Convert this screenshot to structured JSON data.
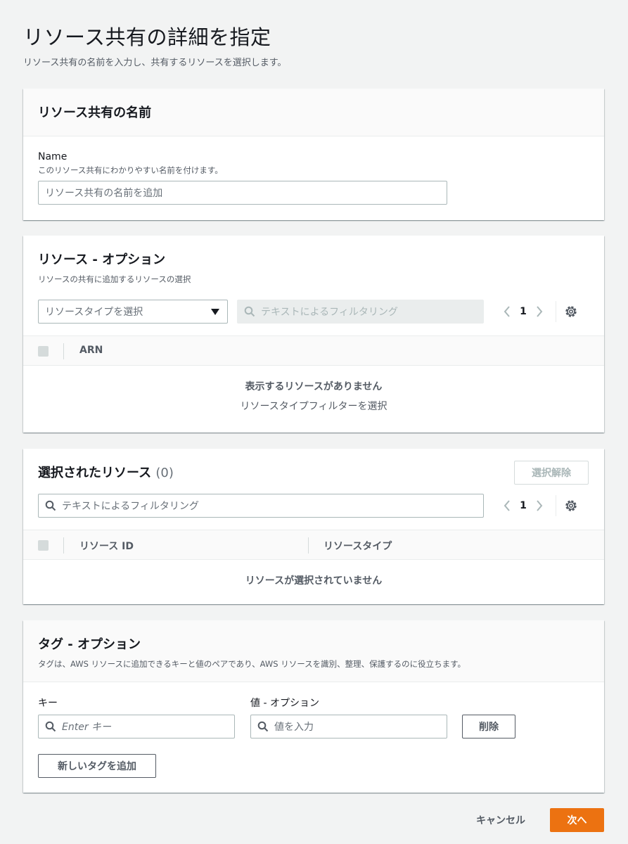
{
  "page": {
    "title": "リソース共有の詳細を指定",
    "description": "リソース共有の名前を入力し、共有するリソースを選択します。"
  },
  "name_panel": {
    "title": "リソース共有の名前",
    "field_label": "Name",
    "field_hint": "このリソース共有にわかりやすい名前を付けます。",
    "input_placeholder": "リソース共有の名前を追加"
  },
  "resources_panel": {
    "title": "リソース - オプション",
    "description": "リソースの共有に追加するリソースの選択",
    "type_select_placeholder": "リソースタイプを選択",
    "filter_placeholder": "テキストによるフィルタリング",
    "page_number": "1",
    "column_arn": "ARN",
    "empty_title": "表示するリソースがありません",
    "empty_subtitle": "リソースタイプフィルターを選択"
  },
  "selected_panel": {
    "title": "選択されたリソース",
    "count": "(0)",
    "deselect_button": "選択解除",
    "filter_placeholder": "テキストによるフィルタリング",
    "page_number": "1",
    "column_resource_id": "リソース ID",
    "column_resource_type": "リソースタイプ",
    "empty_title": "リソースが選択されていません"
  },
  "tags_panel": {
    "title": "タグ - オプション",
    "description": "タグは、AWS リソースに追加できるキーと値のペアであり、AWS リソースを識別、整理、保護するのに役立ちます。",
    "key_label": "キー",
    "value_label": "値 - オプション",
    "key_placeholder": "Enter キー",
    "value_placeholder": "値を入力",
    "remove_button": "削除",
    "add_tag_button": "新しいタグを追加"
  },
  "footer": {
    "cancel_button": "キャンセル",
    "next_button": "次へ"
  },
  "icons": {
    "search": "search-icon",
    "caret_down": "caret-down-icon",
    "chevron_left": "chevron-left-icon",
    "chevron_right": "chevron-right-icon",
    "settings": "gear-icon"
  },
  "colors": {
    "primary": "#ec7211",
    "background": "#f2f3f3",
    "text": "#16191f",
    "muted_text": "#545b64"
  }
}
